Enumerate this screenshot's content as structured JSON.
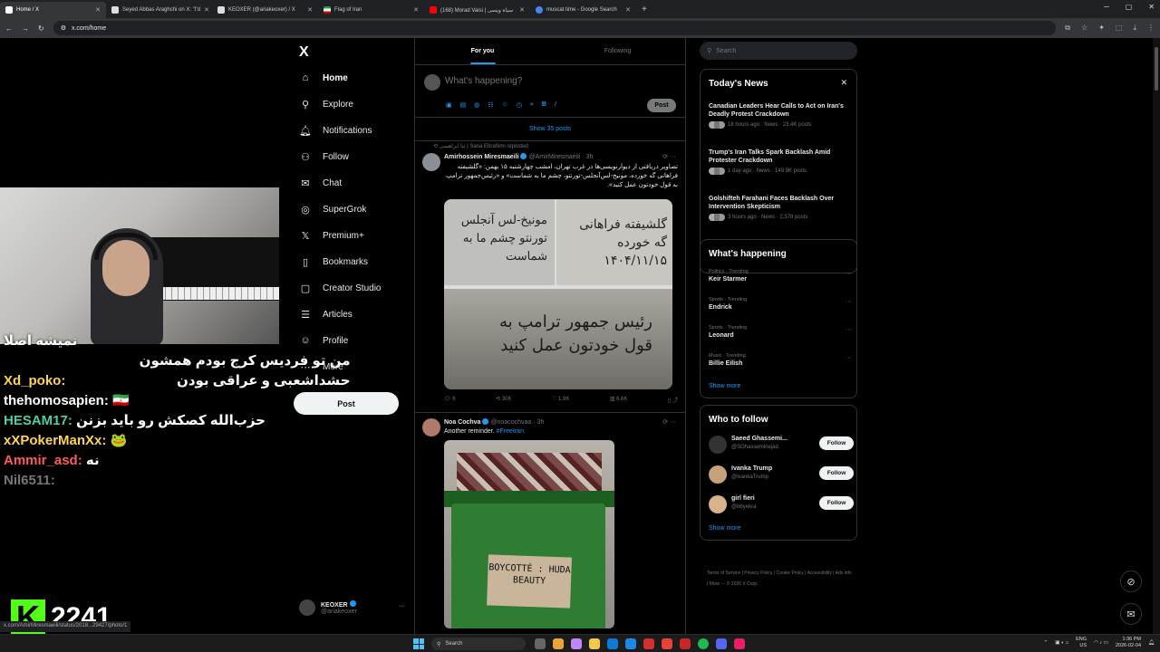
{
  "browser": {
    "tabs": [
      {
        "title": "Home / X",
        "color": "#ffffff"
      },
      {
        "title": "Seyed Abbas Araghchi on X: \"I'd",
        "color": "#ffffff"
      },
      {
        "title": "KEOXER (@ariakeoxer) / X",
        "color": "#ffffff"
      },
      {
        "title": "Flag of Iran",
        "color": "#239f40"
      },
      {
        "title": "(168) Morad Vaisi | سیاه ویسی",
        "color": "#ff0000"
      },
      {
        "title": "muscat time - Google Search",
        "color": "#4285f4"
      }
    ],
    "new_tab": "+",
    "url": "x.com/home"
  },
  "nav": {
    "logo": "X",
    "items": [
      {
        "label": "Home",
        "icon": "⌂",
        "name": "home"
      },
      {
        "label": "Explore",
        "icon": "⚲",
        "name": "explore"
      },
      {
        "label": "Notifications",
        "icon": "🔔︎",
        "name": "notifications"
      },
      {
        "label": "Follow",
        "icon": "⚇",
        "name": "follow"
      },
      {
        "label": "Chat",
        "icon": "✉",
        "name": "chat"
      },
      {
        "label": "SuperGrok",
        "icon": "◎",
        "name": "supergrok"
      },
      {
        "label": "Premium+",
        "icon": "𝕏",
        "name": "premium"
      },
      {
        "label": "Bookmarks",
        "icon": "▯",
        "name": "bookmarks"
      },
      {
        "label": "Creator Studio",
        "icon": "▢",
        "name": "creator-studio"
      },
      {
        "label": "Articles",
        "icon": "☰",
        "name": "articles"
      },
      {
        "label": "Profile",
        "icon": "☺",
        "name": "profile"
      },
      {
        "label": "More",
        "icon": "⋯",
        "name": "more"
      }
    ],
    "post": "Post",
    "account": {
      "name": "KEOXER",
      "handle": "@ariakeoxer",
      "dots": "···"
    }
  },
  "stream": {
    "chat": [
      {
        "user": "",
        "msg": "نمیشه اصلا",
        "color": "#ffffff"
      },
      {
        "user": "Xd_poko:",
        "msg": "من تو فردیس کرج بودم همشون حشداشعبی و عراقی بودن",
        "color": "#ffd54f"
      },
      {
        "user": "thehomosapien:",
        "msg": "🇮🇷",
        "color": "#ffffff"
      },
      {
        "user": "HESAM17:",
        "msg": "حزب‌الله کصکش رو باید بزنن",
        "color": "#4dd0a0"
      },
      {
        "user": "xXPokerManXx:",
        "msg": "🐸",
        "color": "#ffd54f"
      },
      {
        "user": "Ammir_asd:",
        "msg": "نه",
        "color": "#ff5a5a"
      },
      {
        "user": "Nil6511:",
        "msg": "",
        "color": "#777777"
      }
    ],
    "viewer_logo": "K",
    "viewers": "2241",
    "status_url": "x.com/AmirMiresmaeili/status/2018...29427/photo/1"
  },
  "timeline": {
    "tabs": [
      "For you",
      "Following"
    ],
    "compose_placeholder": "What's happening?",
    "compose_tools": [
      "▣",
      "▤",
      "◍",
      "☷",
      "☺",
      "◷",
      "⌖",
      "B",
      "I"
    ],
    "post_button": "Post",
    "show_posts": "Show 35 posts",
    "tweet1": {
      "repost": "⟲ ثنا ابراهیمی | Sana Ebrahimi reposted",
      "name": "Amirhossein Miresmaeili",
      "handle": "@AmirMiresmaeili · 3h",
      "text": "تصاویر دریافتی از دیوارنویسی‌ها در غرب تهران، امشب چهارشنبه ۱۵ بهمن: «گلشیفته فراهانی گه خورده، مونیخ-لس‌آنجلس-تورنتو، چشم ما به شماست» و «رئیس‌جمهور ترامپ به قول خودتون عمل کنید».",
      "scrawl1": "مونیخ-لس آنجلس تورنتو چشم ما به شماست",
      "scrawl2": "گلشیفته فراهانی گه خورده ۱۴۰۴/۱۱/۱۵",
      "scrawl3": "رئیس جمهور ترامپ به قول خودتون عمل کنید",
      "replies": "6",
      "reposts": "30K",
      "likes": "1.9K",
      "views": "6.6K"
    },
    "tweet2": {
      "name": "Noa Cochva",
      "handle": "@noacochvaa · 3h",
      "text": "Another reminder.",
      "hashtag": "#FreeIran",
      "card_text": "BOYCOTTÉ : HUDA BEAUTY"
    }
  },
  "right": {
    "search_placeholder": "Search",
    "today_news": {
      "title": "Today's News",
      "close": "✕",
      "items": [
        {
          "title": "Canadian Leaders Hear Calls to Act on Iran's Deadly Protest Crackdown",
          "meta": "18 hours ago · News · 23.4K posts"
        },
        {
          "title": "Trump's Iran Talks Spark Backlash Amid Protester Crackdown",
          "meta": "1 day ago · News · 149.9K posts"
        },
        {
          "title": "Golshifteh Farahani Faces Backlash Over Intervention Skepticism",
          "meta": "3 hours ago · News · 2,378 posts"
        }
      ]
    },
    "happening": {
      "title": "What's happening",
      "items": [
        {
          "cat": "Politics · Trending",
          "name": "Keir Starmer"
        },
        {
          "cat": "Sports · Trending",
          "name": "Endrick"
        },
        {
          "cat": "Sports · Trending",
          "name": "Leonard"
        },
        {
          "cat": "Music · Trending",
          "name": "Billie Eilish"
        }
      ],
      "show_more": "Show more"
    },
    "who": {
      "title": "Who to follow",
      "items": [
        {
          "name": "Saeed Ghassemi...",
          "handle": "@SGhasseminejad",
          "btn": "Follow"
        },
        {
          "name": "Ivanka Trump",
          "handle": "@IvankaTrump",
          "btn": "Follow"
        },
        {
          "name": "girl fieri",
          "handle": "@bbyekra",
          "btn": "Follow"
        }
      ],
      "show_more": "Show more"
    },
    "footer": "Terms of Service | Privacy Policy | Cookie Policy | Accessibility | Ads info | More ··· © 2026 X Corp."
  },
  "taskbar": {
    "search": "Search",
    "lang": "ENG",
    "region": "US",
    "time": "1:36 PM",
    "date": "2026-02-04"
  }
}
